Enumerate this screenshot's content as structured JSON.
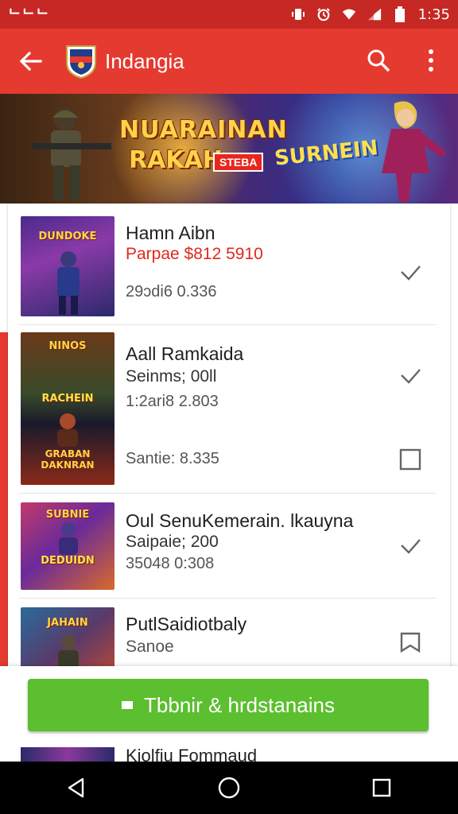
{
  "status_bar": {
    "left_text": "ᄂᄂᄂ",
    "time": "1:35",
    "icons": [
      "vibrate-icon",
      "alarm-icon",
      "wifi-icon",
      "signal-icon",
      "battery-icon"
    ]
  },
  "app_bar": {
    "title": "Indangia",
    "icons": [
      "back-arrow-icon",
      "app-logo",
      "search-icon",
      "overflow-menu-icon"
    ]
  },
  "banner": {
    "title_line1": "NUARAINAN",
    "title_line2": "RAKAH",
    "tag": "STEBA",
    "right_title": "SURNEIN"
  },
  "items": [
    {
      "title": "Hamn Aibn",
      "price": "Parpae $812 5910",
      "sub": "29ɔdi6 0.336",
      "thumb_text": "DUNDOKE",
      "check_icon": "check-icon"
    },
    {
      "title": "Aall Ramkaida",
      "sub2": "Seinms; 00ll",
      "sub": "1:2ari8 2.803",
      "thumb_text_top": "NINOS",
      "thumb_text_mid": "RACHEIN",
      "thumb_text_bottom": "GRABAN DAKNRAN",
      "check_icon": "check-icon"
    },
    {
      "title": "",
      "sub": "Santie: 8.335",
      "check_icon": "checkbox-empty-icon"
    },
    {
      "title": "Oul SenuKemerain. lkauyna",
      "sub2": "Saipaie; 200",
      "sub": "35048 0:308",
      "thumb_text_top": "SUBNIE",
      "thumb_text_bottom": "DEDUIDN",
      "check_icon": "check-icon"
    },
    {
      "title": "PutlSaidiotbaly",
      "sub": "Sanoe",
      "thumb_text": "JAHAIN",
      "check_icon": "bookmark-icon"
    }
  ],
  "cta": {
    "label": "Tbbnir & hrdstanains"
  },
  "peek_item": {
    "title": "Kiolfiu Fommaud"
  },
  "navbar": {
    "icons": [
      "nav-back-icon",
      "nav-home-icon",
      "nav-recents-icon"
    ]
  },
  "colors": {
    "status_bar": "#c62824",
    "app_bar": "#e53a2f",
    "price": "#e0281f",
    "cta": "#5bbf2f"
  }
}
